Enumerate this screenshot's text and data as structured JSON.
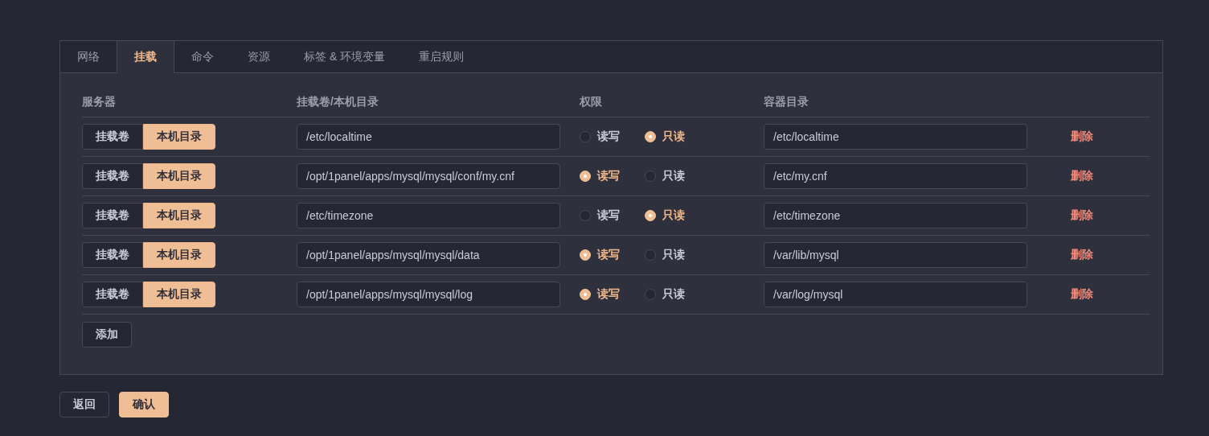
{
  "tabs": [
    {
      "label": "网络",
      "selected": false
    },
    {
      "label": "挂载",
      "selected": true
    },
    {
      "label": "命令",
      "selected": false
    },
    {
      "label": "资源",
      "selected": false
    },
    {
      "label": "标签 & 环境变量",
      "selected": false
    },
    {
      "label": "重启规则",
      "selected": false
    }
  ],
  "table": {
    "columns": [
      "服务器",
      "挂载卷/本机目录",
      "权限",
      "容器目录"
    ],
    "rows": [
      {
        "source": [
          {
            "label": "挂载卷",
            "selected": false
          },
          {
            "label": "本机目录",
            "selected": true
          }
        ],
        "path": "/etc/localtime",
        "mode": [
          {
            "label": "读写",
            "selected": false
          },
          {
            "label": "只读",
            "selected": true
          }
        ],
        "container": "/etc/localtime",
        "action": "删除"
      },
      {
        "source": [
          {
            "label": "挂载卷",
            "selected": false
          },
          {
            "label": "本机目录",
            "selected": true
          }
        ],
        "path": "/opt/1panel/apps/mysql/mysql/conf/my.cnf",
        "mode": [
          {
            "label": "读写",
            "selected": true
          },
          {
            "label": "只读",
            "selected": false
          }
        ],
        "container": "/etc/my.cnf",
        "action": "删除"
      },
      {
        "source": [
          {
            "label": "挂载卷",
            "selected": false
          },
          {
            "label": "本机目录",
            "selected": true
          }
        ],
        "path": "/etc/timezone",
        "mode": [
          {
            "label": "读写",
            "selected": false
          },
          {
            "label": "只读",
            "selected": true
          }
        ],
        "container": "/etc/timezone",
        "action": "删除"
      },
      {
        "source": [
          {
            "label": "挂载卷",
            "selected": false
          },
          {
            "label": "本机目录",
            "selected": true
          }
        ],
        "path": "/opt/1panel/apps/mysql/mysql/data",
        "mode": [
          {
            "label": "读写",
            "selected": true
          },
          {
            "label": "只读",
            "selected": false
          }
        ],
        "container": "/var/lib/mysql",
        "action": "删除"
      },
      {
        "source": [
          {
            "label": "挂载卷",
            "selected": false
          },
          {
            "label": "本机目录",
            "selected": true
          }
        ],
        "path": "/opt/1panel/apps/mysql/mysql/log",
        "mode": [
          {
            "label": "读写",
            "selected": true
          },
          {
            "label": "只读",
            "selected": false
          }
        ],
        "container": "/var/log/mysql",
        "action": "删除"
      }
    ],
    "add_button": "添加"
  },
  "footer_buttons": [
    {
      "label": "返回",
      "kind": "default"
    },
    {
      "label": "确认",
      "kind": "primary"
    }
  ]
}
